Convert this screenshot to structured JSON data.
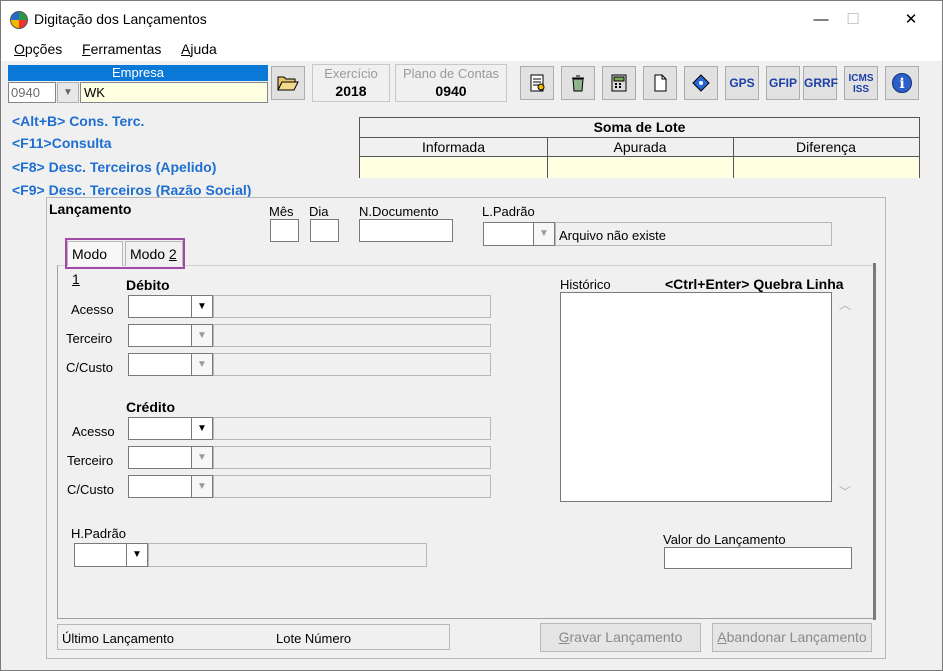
{
  "window": {
    "title": "Digitação dos Lançamentos",
    "minimize_glyph": "—",
    "maximize_glyph": "☐",
    "close_glyph": "✕"
  },
  "menu": [
    {
      "label": "Opções",
      "accel": "O",
      "rest": "pções"
    },
    {
      "label": "Ferramentas",
      "accel": "F",
      "rest": "erramentas"
    },
    {
      "label": "Ajuda",
      "accel": "A",
      "rest": "juda"
    }
  ],
  "empresa": {
    "label": "Empresa",
    "code": "0940",
    "name": "WK"
  },
  "exercicio": {
    "label": "Exercício",
    "value": "2018"
  },
  "plano_contas": {
    "label": "Plano de Contas",
    "value": "0940"
  },
  "toolbar": {
    "gps": "GPS",
    "gfip": "GFIP",
    "grrf": "GRRF",
    "icms_1": "ICMS",
    "icms_2": "ISS",
    "info": "i"
  },
  "hotkeys": [
    "<Alt+B> Cons. Terc.",
    "<F11>Consulta",
    "<F8> Desc. Terceiros (Apelido)",
    "<F9> Desc. Terceiros (Razão Social)"
  ],
  "soma_lote": {
    "title": "Soma de Lote",
    "columns": [
      "Informada",
      "Apurada",
      "Diferença"
    ]
  },
  "lancamento": {
    "title": "Lançamento",
    "mes": "Mês",
    "dia": "Dia",
    "n_documento": "N.Documento",
    "l_padrao": "L.Padrão",
    "arquivo_status": "Arquivo não existe"
  },
  "tabs": [
    {
      "prefix": "Modo ",
      "accel": "1"
    },
    {
      "prefix": "Modo ",
      "accel": "2"
    }
  ],
  "debito": {
    "title": "Débito",
    "rows": [
      "Acesso",
      "Terceiro",
      "C/Custo"
    ]
  },
  "credito": {
    "title": "Crédito",
    "rows": [
      "Acesso",
      "Terceiro",
      "C/Custo"
    ]
  },
  "historico": {
    "label": "Histórico",
    "hint": "<Ctrl+Enter> Quebra Linha"
  },
  "h_padrao": "H.Padrão",
  "valor_lancamento": "Valor do Lançamento",
  "status": {
    "ultimo": "Último Lançamento",
    "lote": "Lote Número"
  },
  "buttons": {
    "gravar_accel": "G",
    "gravar_rest": "ravar Lançamento",
    "abandonar_accel": "A",
    "abandonar_rest": "bandonar Lançamento"
  },
  "colors": {
    "accent_blue": "#0a78d7",
    "hotkey_blue": "#1e6fd0",
    "tab_highlight": "#a24aa8",
    "input_yellow": "#ffffe1"
  }
}
